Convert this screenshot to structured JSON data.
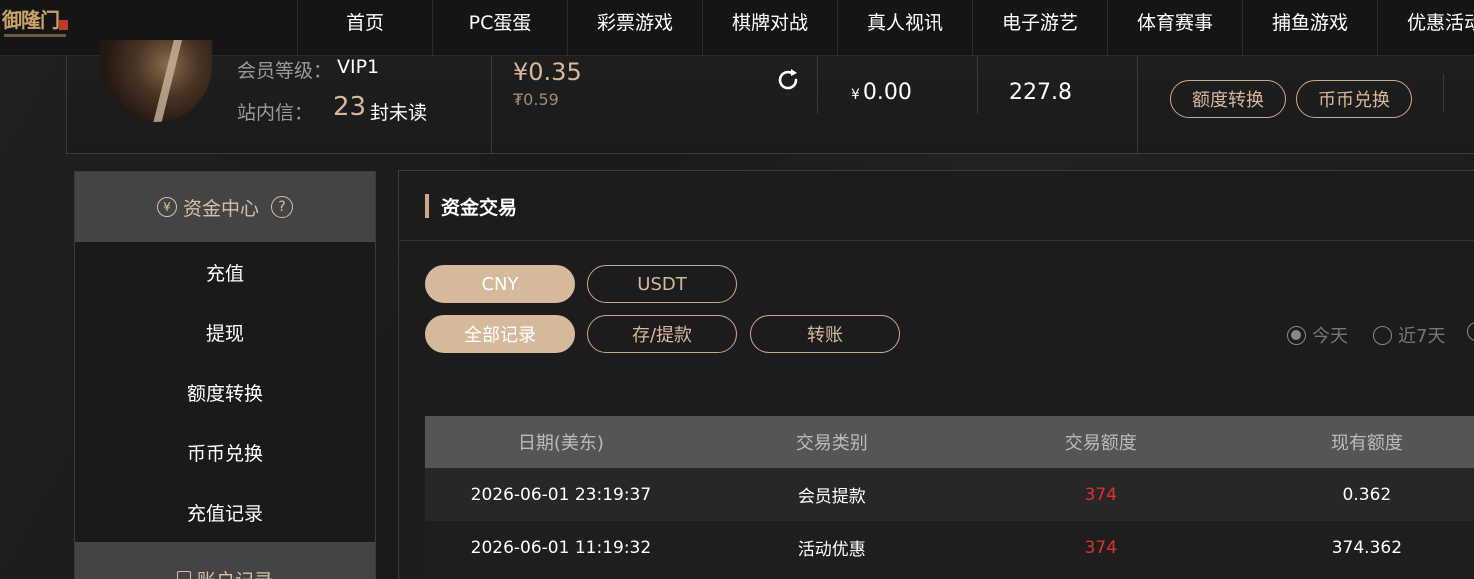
{
  "nav": {
    "items": [
      "首页",
      "PC蛋蛋",
      "彩票游戏",
      "棋牌对战",
      "真人视讯",
      "电子游艺",
      "体育赛事",
      "捕鱼游戏",
      "优惠活动"
    ]
  },
  "member": {
    "level_label": "会员等级：",
    "level_value": "VIP1",
    "msg_label": "站内信：",
    "msg_count": "23",
    "msg_unread": "封未读",
    "balance_main": "¥0.35",
    "balance_sub": "₮0.59",
    "wallet1_currency": "¥",
    "wallet1_value": "0.00",
    "wallet2_value": "227.8",
    "btn_transfer": "额度转换",
    "btn_exchange": "币币兑换"
  },
  "sidebar": {
    "section1_title": "资金中心",
    "help_mark": "?",
    "items": [
      "充值",
      "提现",
      "额度转换",
      "币币兑换",
      "充值记录"
    ],
    "section2_title": "账户记录"
  },
  "main": {
    "title": "资金交易",
    "currency_tabs": [
      "CNY",
      "USDT"
    ],
    "record_tabs": [
      "全部记录",
      "存/提款",
      "转账"
    ],
    "ranges": [
      "今天",
      "近7天"
    ],
    "table": {
      "headers": [
        "日期(美东)",
        "交易类别",
        "交易额度",
        "现有额度"
      ],
      "rows": [
        [
          "2026-06-01 23:19:37",
          "会员提款",
          "374",
          "0.362"
        ],
        [
          "2026-06-01 11:19:32",
          "活动优惠",
          "374",
          "374.362"
        ]
      ]
    }
  },
  "colors": {
    "accent": "#d4b99a",
    "negative": "#e03030",
    "background": "#1b1b1b"
  }
}
